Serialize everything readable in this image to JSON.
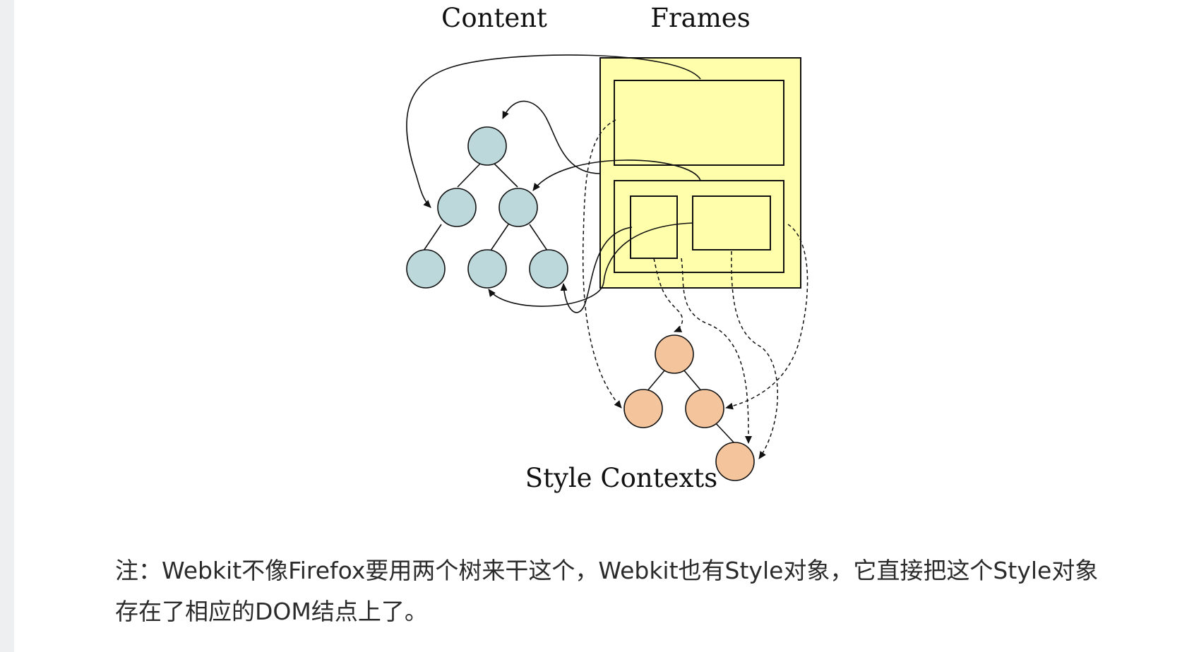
{
  "figure": {
    "labels": {
      "content": "Content",
      "frames": "Frames",
      "style_contexts": "Style Contexts"
    },
    "colors": {
      "content_node": "#bcd8db",
      "style_node": "#f4c49c",
      "frame_fill": "#ffffab",
      "stroke": "#111111"
    }
  },
  "note": {
    "text": "注：Webkit不像Firefox要用两个树来干这个，Webkit也有Style对象，它直接把这个Style对象存在了相应的DOM结点上了。"
  }
}
